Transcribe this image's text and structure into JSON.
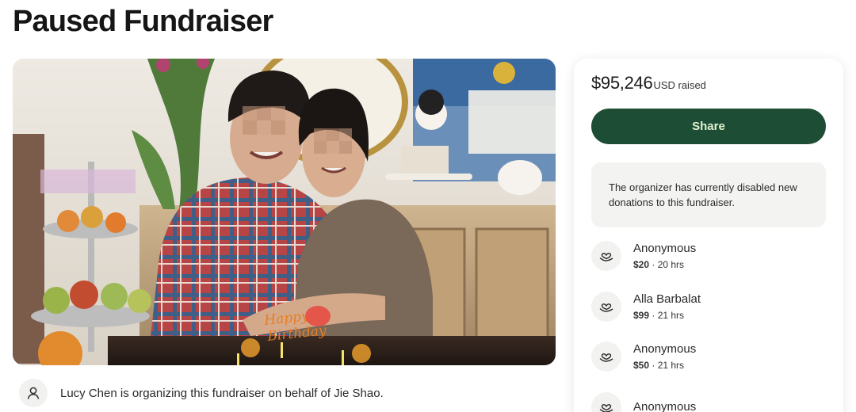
{
  "page": {
    "title": "Paused Fundraiser"
  },
  "photo": {
    "cake_text_line1": "Happy",
    "cake_text_line2": "Birthday"
  },
  "organizer": {
    "icon": "person-icon",
    "text": "Lucy Chen is organizing this fundraiser on behalf of Jie Shao."
  },
  "sidebar": {
    "raised_amount": "$95,246",
    "raised_suffix": "USD raised",
    "share_label": "Share",
    "notice": "The organizer has currently disabled new donations to this fundraiser.",
    "donations": [
      {
        "name": "Anonymous",
        "amount": "$20",
        "time": "20 hrs",
        "icon": "heart-hand-icon"
      },
      {
        "name": "Alla Barbalat",
        "amount": "$99",
        "time": "21 hrs",
        "icon": "heart-hand-icon"
      },
      {
        "name": "Anonymous",
        "amount": "$50",
        "time": "21 hrs",
        "icon": "heart-hand-icon"
      },
      {
        "name": "Anonymous",
        "amount": "",
        "time": "",
        "icon": "heart-hand-icon"
      }
    ]
  },
  "colors": {
    "share_button_bg": "#1e4d35",
    "share_button_text": "#dff3d1",
    "notice_bg": "#f3f3f2"
  }
}
